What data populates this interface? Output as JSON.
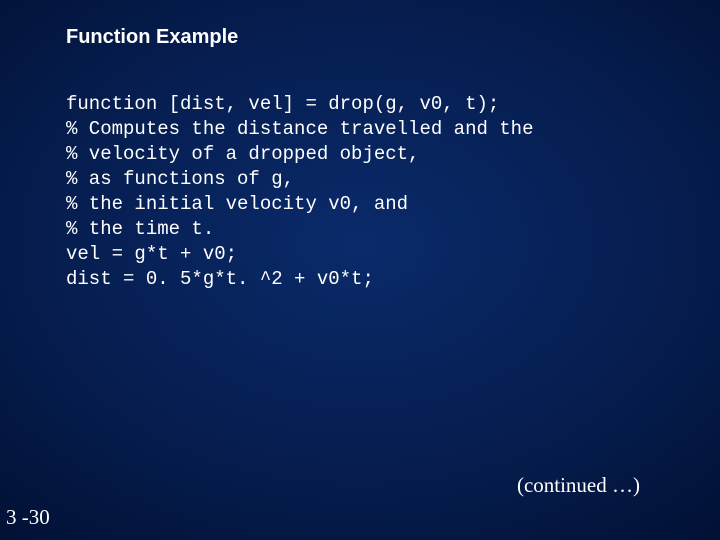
{
  "slide": {
    "title": "Function Example",
    "code": "function [dist, vel] = drop(g, v0, t);\n% Computes the distance travelled and the\n% velocity of a dropped object,\n% as functions of g,\n% the initial velocity v0, and\n% the time t.\nvel = g*t + v0;\ndist = 0. 5*g*t. ^2 + v0*t;",
    "continued": "(continued …)",
    "page": "3 -30"
  }
}
